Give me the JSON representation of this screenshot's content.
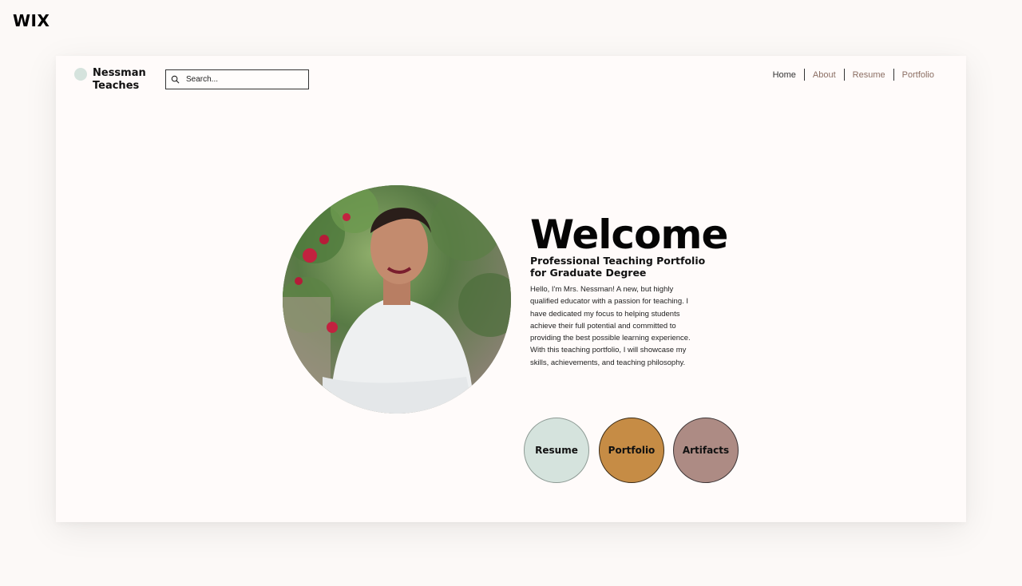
{
  "app": {
    "logo": "WIX"
  },
  "header": {
    "brand_name": "Nessman Teaches",
    "search": {
      "placeholder": "Search...",
      "value": ""
    },
    "nav": [
      {
        "label": "Home",
        "active": true
      },
      {
        "label": "About",
        "active": false
      },
      {
        "label": "Resume",
        "active": false
      },
      {
        "label": "Portfolio",
        "active": false
      }
    ]
  },
  "hero": {
    "title": "Welcome",
    "subtitle": "Professional Teaching Portfolio for Graduate Degree",
    "intro": "Hello, I'm Mrs. Nessman! A new, but highly qualified educator with a passion for teaching. I have dedicated my focus to helping students achieve their full potential and committed to providing the best possible learning experience. With this teaching portfolio, I will showcase my skills, achievements, and teaching philosophy."
  },
  "buttons": [
    {
      "label": "Resume",
      "color": "#d5e3dd"
    },
    {
      "label": "Portfolio",
      "color": "#c68c45"
    },
    {
      "label": "Artifacts",
      "color": "#ad8b84"
    }
  ],
  "colors": {
    "page_bg": "#fcf9f7",
    "frame_bg": "#fffbfa",
    "nav_link": "#8b6e63",
    "brand_dot": "#d5e3dd"
  }
}
